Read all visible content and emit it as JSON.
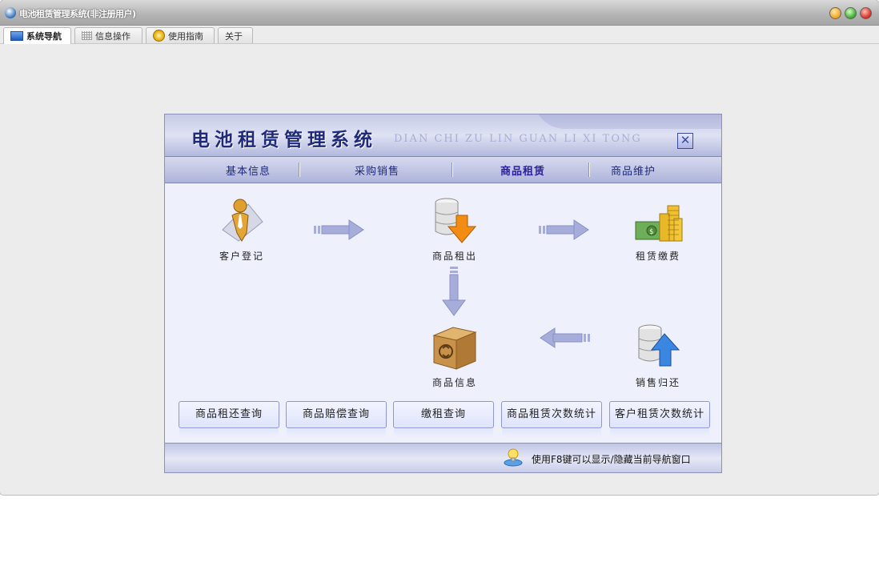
{
  "window": {
    "title": "电池租赁管理系统(非注册用户)"
  },
  "tabs": [
    {
      "label": "系统导航",
      "active": true,
      "icon": "monitor-icon"
    },
    {
      "label": "信息操作",
      "active": false,
      "icon": "grid-icon"
    },
    {
      "label": "使用指南",
      "active": false,
      "icon": "guide-icon"
    },
    {
      "label": "关于",
      "active": false,
      "icon": ""
    }
  ],
  "panel": {
    "title": "电池租赁管理系统",
    "pinyin": "DIAN CHI ZU LIN GUAN LI XI TONG",
    "menu": [
      {
        "label": "基本信息",
        "active": false
      },
      {
        "label": "采购销售",
        "active": false
      },
      {
        "label": "商品租赁",
        "active": true
      },
      {
        "label": "商品维护",
        "active": false
      }
    ],
    "flow": {
      "customer_register": "客户登记",
      "goods_rent_out": "商品租出",
      "rent_payment": "租赁缴费",
      "goods_info": "商品信息",
      "sales_return": "销售归还"
    },
    "queries": [
      "商品租还查询",
      "商品赔偿查询",
      "缴租查询",
      "商品租赁次数统计",
      "客户租赁次数统计"
    ],
    "footer_tip": "使用F8键可以显示/隐藏当前导航窗口"
  },
  "colors": {
    "accent": "#1f2a7a",
    "panel_bg": "#eef0fb",
    "arrow": "#a7addb",
    "orange_arrow": "#f28c12",
    "blue_arrow": "#3a86e0"
  }
}
